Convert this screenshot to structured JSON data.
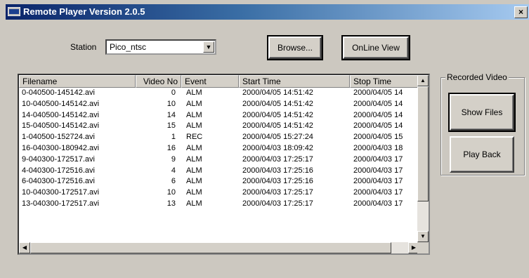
{
  "window": {
    "title": "Remote Player Version 2.0.5",
    "close_glyph": "×",
    "app_icon": "app-window-icon"
  },
  "station": {
    "label": "Station",
    "value": "Pico_ntsc"
  },
  "buttons": {
    "browse": "Browse...",
    "online_view": "OnLine View",
    "show_files": "Show Files",
    "play_back": "Play Back"
  },
  "recorded_group": {
    "label": "Recorded Video"
  },
  "table": {
    "columns": [
      "Filename",
      "Video No",
      "Event",
      "Start Time",
      "Stop Time"
    ],
    "rows": [
      [
        "0-040500-145142.avi",
        "0",
        "ALM",
        "2000/04/05 14:51:42",
        "2000/04/05 14"
      ],
      [
        "10-040500-145142.avi",
        "10",
        "ALM",
        "2000/04/05 14:51:42",
        "2000/04/05 14"
      ],
      [
        "14-040500-145142.avi",
        "14",
        "ALM",
        "2000/04/05 14:51:42",
        "2000/04/05 14"
      ],
      [
        "15-040500-145142.avi",
        "15",
        "ALM",
        "2000/04/05 14:51:42",
        "2000/04/05 14"
      ],
      [
        "1-040500-152724.avi",
        "1",
        "REC",
        "2000/04/05 15:27:24",
        "2000/04/05 15"
      ],
      [
        "16-040300-180942.avi",
        "16",
        "ALM",
        "2000/04/03 18:09:42",
        "2000/04/03 18"
      ],
      [
        "9-040300-172517.avi",
        "9",
        "ALM",
        "2000/04/03 17:25:17",
        "2000/04/03 17"
      ],
      [
        "4-040300-172516.avi",
        "4",
        "ALM",
        "2000/04/03 17:25:16",
        "2000/04/03 17"
      ],
      [
        "6-040300-172516.avi",
        "6",
        "ALM",
        "2000/04/03 17:25:16",
        "2000/04/03 17"
      ],
      [
        "10-040300-172517.avi",
        "10",
        "ALM",
        "2000/04/03 17:25:17",
        "2000/04/03 17"
      ],
      [
        "13-040300-172517.avi",
        "13",
        "ALM",
        "2000/04/03 17:25:17",
        "2000/04/03 17"
      ]
    ]
  },
  "colors": {
    "titlebar_start": "#0a246a",
    "titlebar_end": "#a6caf0",
    "face": "#d4d0c8"
  }
}
